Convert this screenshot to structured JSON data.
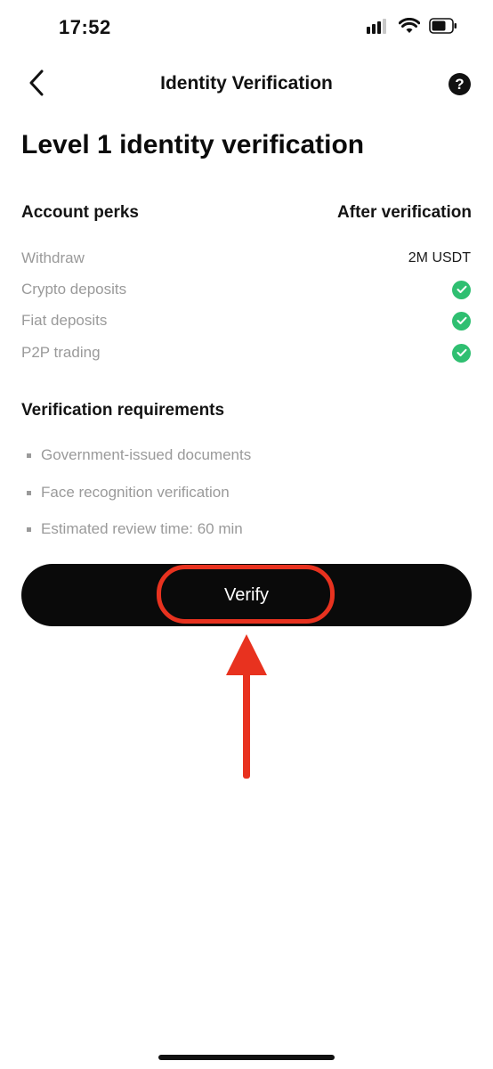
{
  "status_bar": {
    "time": "17:52",
    "icons": [
      "signal-icon",
      "wifi-icon",
      "battery-icon"
    ]
  },
  "nav": {
    "title": "Identity Verification",
    "back_icon": "chevron-left-icon",
    "help_label": "?"
  },
  "page": {
    "title": "Level 1 identity verification"
  },
  "perks": {
    "header_left": "Account perks",
    "header_right": "After verification",
    "rows": [
      {
        "label": "Withdraw",
        "value": "2M USDT"
      },
      {
        "label": "Crypto deposits",
        "value": "check"
      },
      {
        "label": "Fiat deposits",
        "value": "check"
      },
      {
        "label": "P2P trading",
        "value": "check"
      }
    ]
  },
  "requirements": {
    "title": "Verification requirements",
    "items": [
      "Government-issued documents",
      "Face recognition verification",
      "Estimated review time: 60 min"
    ]
  },
  "actions": {
    "verify_label": "Verify"
  },
  "colors": {
    "accent_check": "#2fbf71",
    "button_bg": "#0a0a0a",
    "annotation_red": "#e8321f",
    "muted_text": "#9a9a9a"
  }
}
